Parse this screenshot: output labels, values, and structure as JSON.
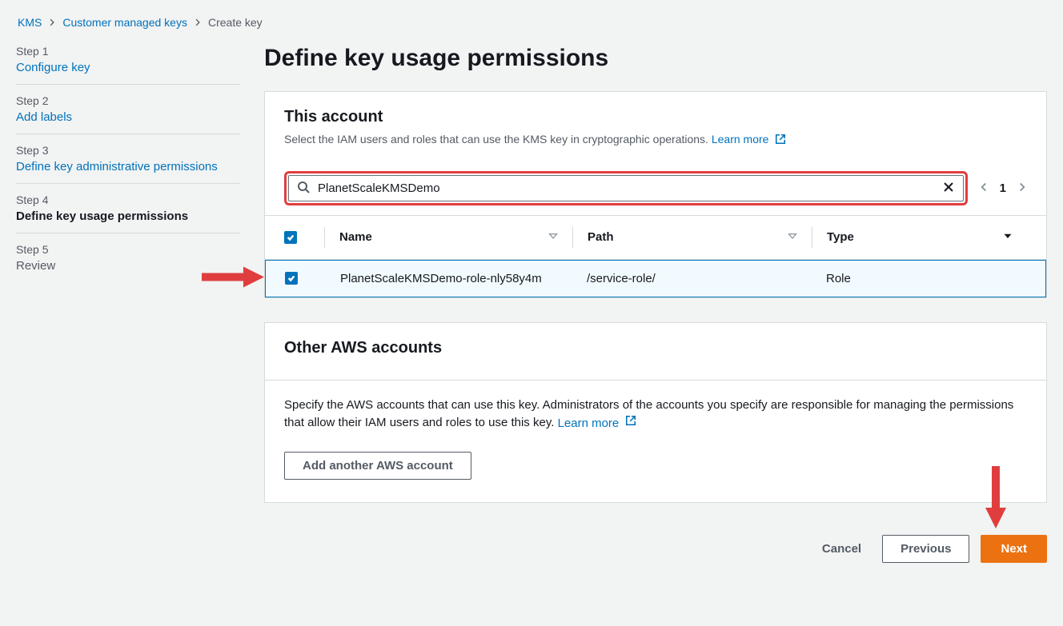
{
  "breadcrumb": {
    "items": [
      "KMS",
      "Customer managed keys",
      "Create key"
    ]
  },
  "sidebar": {
    "steps": [
      {
        "label": "Step 1",
        "title": "Configure key",
        "state": "link"
      },
      {
        "label": "Step 2",
        "title": "Add labels",
        "state": "link"
      },
      {
        "label": "Step 3",
        "title": "Define key administrative permissions",
        "state": "link"
      },
      {
        "label": "Step 4",
        "title": "Define key usage permissions",
        "state": "active"
      },
      {
        "label": "Step 5",
        "title": "Review",
        "state": "future"
      }
    ]
  },
  "page": {
    "title": "Define key usage permissions"
  },
  "thisAccount": {
    "title": "This account",
    "subtitle": "Select the IAM users and roles that can use the KMS key in cryptographic operations.",
    "learnMore": "Learn more",
    "searchValue": "PlanetScaleKMSDemo",
    "pagination": {
      "page": "1"
    },
    "columns": {
      "name": "Name",
      "path": "Path",
      "type": "Type"
    },
    "rows": [
      {
        "checked": true,
        "name": "PlanetScaleKMSDemo-role-nly58y4m",
        "path": "/service-role/",
        "type": "Role"
      }
    ]
  },
  "otherAccounts": {
    "title": "Other AWS accounts",
    "description": "Specify the AWS accounts that can use this key. Administrators of the accounts you specify are responsible for managing the permissions that allow their IAM users and roles to use this key.",
    "learnMore": "Learn more",
    "addButton": "Add another AWS account"
  },
  "footer": {
    "cancel": "Cancel",
    "previous": "Previous",
    "next": "Next"
  }
}
